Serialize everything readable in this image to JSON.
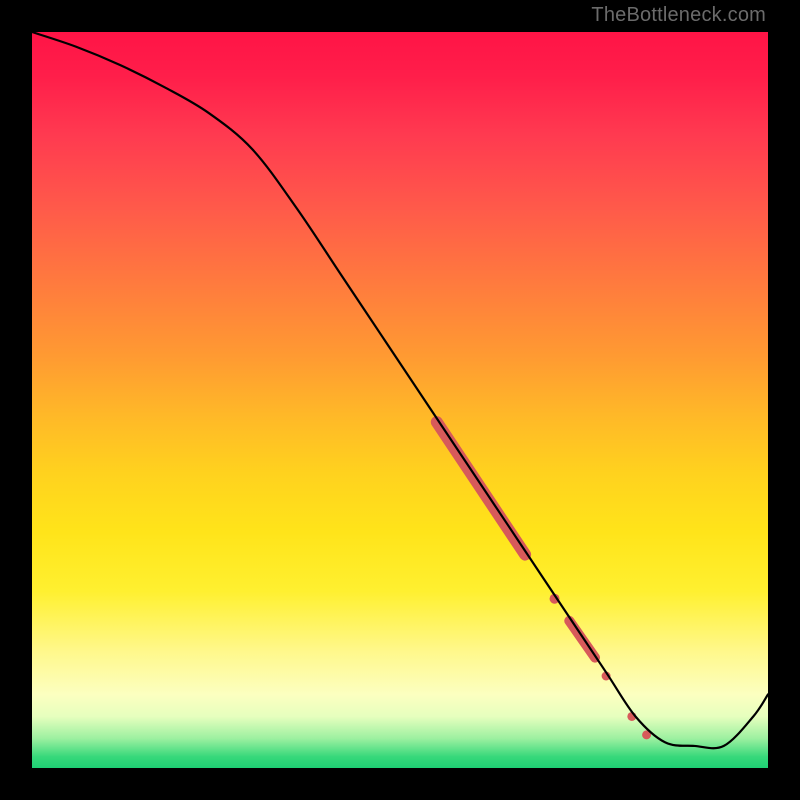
{
  "watermark": "TheBottleneck.com",
  "chart_data": {
    "type": "line",
    "title": "",
    "xlabel": "",
    "ylabel": "",
    "xlim": [
      0,
      100
    ],
    "ylim": [
      0,
      100
    ],
    "grid": false,
    "series": [
      {
        "name": "curve",
        "color": "#000000",
        "x": [
          0,
          6,
          12,
          18,
          24,
          30,
          36,
          42,
          48,
          54,
          60,
          66,
          72,
          78,
          82,
          86,
          90,
          94,
          98,
          100
        ],
        "y": [
          100,
          98,
          95.5,
          92.5,
          89,
          84,
          76,
          67,
          58,
          49,
          40,
          31,
          22,
          13,
          7,
          3.5,
          3,
          3,
          7,
          10
        ]
      }
    ],
    "markers": [
      {
        "shape": "thick-segment",
        "color": "#d75a5a",
        "x0": 55,
        "y0": 47,
        "x1": 67,
        "y1": 29,
        "width": 12
      },
      {
        "shape": "dot",
        "color": "#d75a5a",
        "x": 71,
        "y": 23,
        "r": 5
      },
      {
        "shape": "thick-segment",
        "color": "#d75a5a",
        "x0": 73,
        "y0": 20,
        "x1": 76.5,
        "y1": 15,
        "width": 10
      },
      {
        "shape": "dot",
        "color": "#d75a5a",
        "x": 78,
        "y": 12.5,
        "r": 4.5
      },
      {
        "shape": "dot",
        "color": "#d75a5a",
        "x": 81.5,
        "y": 7,
        "r": 4.5
      },
      {
        "shape": "dot",
        "color": "#d75a5a",
        "x": 83.5,
        "y": 4.5,
        "r": 4.5
      }
    ]
  }
}
